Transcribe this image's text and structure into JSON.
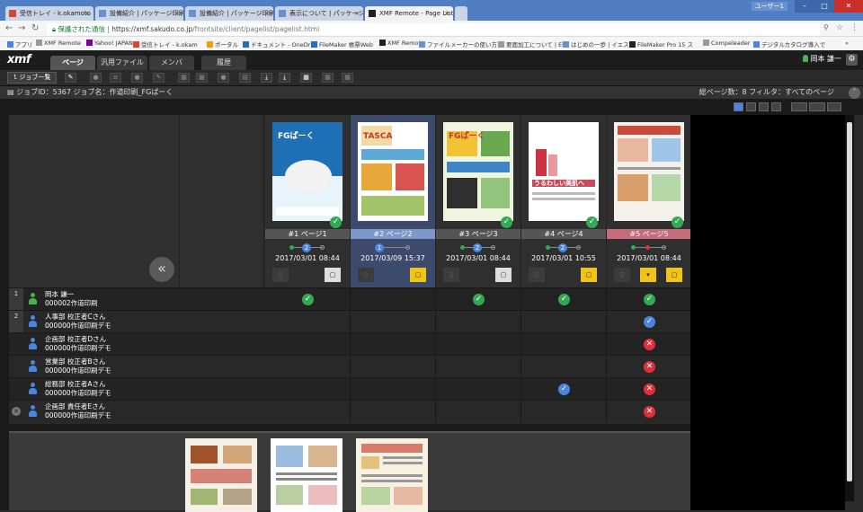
{
  "browser": {
    "tabs": [
      {
        "label": "受信トレイ - k.okamoto",
        "icon_color": "#d44638"
      },
      {
        "label": "設備紹介 | パッケージ印刷",
        "icon_color": "#6b90cf"
      },
      {
        "label": "設備紹介 | パッケージ印刷",
        "icon_color": "#6b90cf"
      },
      {
        "label": "表示について | パッケージ印",
        "icon_color": "#6b90cf"
      },
      {
        "label": "XMF Remote - Page List",
        "icon_color": "#222"
      }
    ],
    "user_label": "ユーザー1",
    "url_secure": "保護された通信",
    "url_host": "https://xmf.sakudo.co.jp",
    "url_path": "/frontsite/client/pagelist/pagelist.html",
    "bookmarks": [
      "アプリ",
      "XMF Remote",
      "Yahoo! JAPAN",
      "受信トレイ - k.okam",
      "ポータル",
      "ドキュメント - OneDriv",
      "FileMaker 帳票Web",
      "XMF Remote",
      "ファイルメーカーの使い方",
      "要面加工について | El",
      "はじめの一歩 | イエス",
      "FileMaker Pro 15 ス",
      "Compeleader",
      "デジタルカタログ導入で"
    ],
    "bookmarks_more": "»"
  },
  "app": {
    "logo": "xmf",
    "tabs": [
      "ページ",
      "汎用ファイル",
      "メンバ",
      "履歴"
    ],
    "user": "岡本 謙一",
    "job_list_button": "ジョブ一覧",
    "info_left": "ジョブID：5367  ジョブ名：作道印刷_FGぱーく",
    "info_right": "総ページ数：8  フィルタ：すべてのページ"
  },
  "pages": [
    {
      "label": "#1 ページ1",
      "date": "2017/03/01 08:44",
      "state": "normal",
      "step": "2",
      "done": true,
      "thumb_color": "#1f6fb4",
      "thumb_title": "FGぱーく",
      "note_color": "#ddd"
    },
    {
      "label": "#2 ページ2",
      "date": "2017/03/09 15:37",
      "state": "selected",
      "step": "1",
      "done": false,
      "thumb_color": "#ffffff",
      "thumb_title": "TASCA",
      "note_color": "#f0c419"
    },
    {
      "label": "#3 ページ3",
      "date": "2017/03/01 08:44",
      "state": "normal",
      "step": "2",
      "done": true,
      "thumb_color": "#e8d9a0",
      "thumb_title": "FGぱーく",
      "note_color": "#ddd"
    },
    {
      "label": "#4 ページ4",
      "date": "2017/03/01 10:55",
      "state": "normal",
      "step": "2",
      "done": true,
      "thumb_color": "#f6e8ec",
      "thumb_title": "うるわしい美肌へ",
      "note_color": "#f0c419"
    },
    {
      "label": "#5 ページ5",
      "date": "2017/03/01 08:44",
      "state": "alert",
      "step": "",
      "done": true,
      "thumb_color": "#f4f0ea",
      "thumb_title": "",
      "note_color": "#f0c419"
    }
  ],
  "members": [
    {
      "num": "1",
      "line1": "岡本 謙一",
      "line2": "000002作道印刷",
      "icon": "#4caf50",
      "marks": [
        "green",
        "",
        "green",
        "green",
        "green"
      ]
    },
    {
      "num": "2",
      "line1": "人事部 校正者Cさん",
      "line2": "000000作道印刷デモ",
      "icon": "#4a86e0",
      "marks": [
        "",
        "",
        "",
        "",
        "blue"
      ]
    },
    {
      "num": "",
      "line1": "企画部 校正者Dさん",
      "line2": "000000作道印刷デモ",
      "icon": "#4a86e0",
      "marks": [
        "",
        "",
        "",
        "",
        "red"
      ]
    },
    {
      "num": "",
      "line1": "営業部 校正者Bさん",
      "line2": "000000作道印刷デモ",
      "icon": "#4a86e0",
      "marks": [
        "",
        "",
        "",
        "",
        "red"
      ]
    },
    {
      "num": "",
      "line1": "総務部 校正者Aさん",
      "line2": "000000作道印刷デモ",
      "icon": "#4a86e0",
      "marks": [
        "",
        "",
        "",
        "blue",
        "red"
      ]
    },
    {
      "num": "",
      "line1": "企画部 責任者Eさん",
      "line2": "000000作道印刷デモ",
      "icon": "#4a86e0",
      "marks": [
        "",
        "",
        "",
        "",
        "red"
      ]
    }
  ],
  "icons": {
    "check": "✓",
    "cross": "✕",
    "back": "«",
    "gear": "⚙",
    "collapse": "˅"
  },
  "colors": {
    "green": "#34a853",
    "blue": "#4a86e0",
    "red": "#e0303c",
    "accent": "#4a86e0"
  }
}
